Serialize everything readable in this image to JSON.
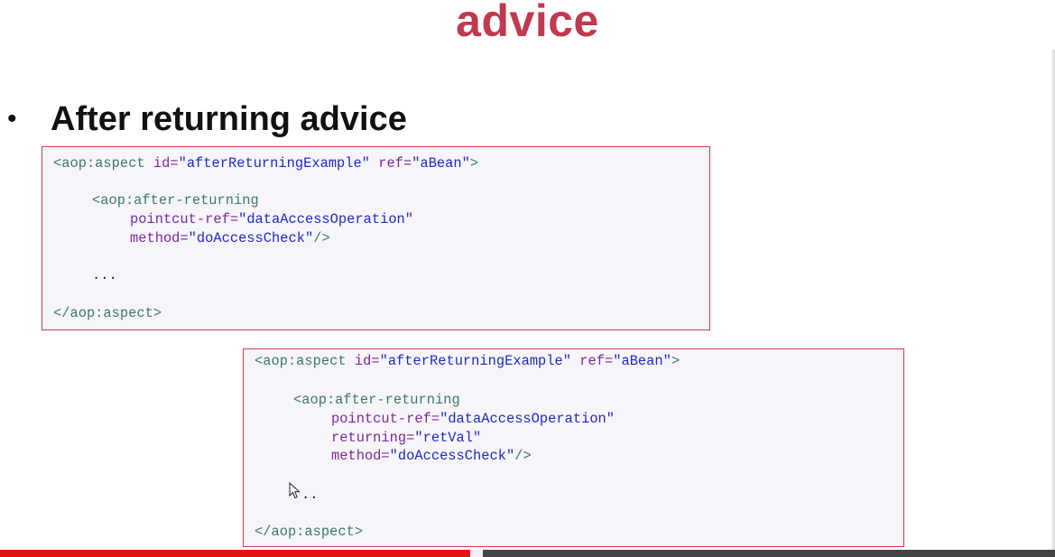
{
  "slide": {
    "title": "advice",
    "bullet": {
      "symbol": "•",
      "text": "After returning advice"
    }
  },
  "code_block_1": {
    "aspect_open": {
      "tag": "<aop:aspect",
      "id_attr": "id=",
      "id_val": "\"afterReturningExample\"",
      "ref_attr": "ref=",
      "ref_val": "\"aBean\"",
      "close": ">"
    },
    "advice_open": "<aop:after-returning",
    "pointcut": {
      "attr": "pointcut-ref=",
      "val": "\"dataAccessOperation\""
    },
    "method": {
      "attr": "method=",
      "val": "\"doAccessCheck\"",
      "close": "/>"
    },
    "ellipsis": "...",
    "aspect_close": "</aop:aspect>"
  },
  "code_block_2": {
    "aspect_open": {
      "tag": "<aop:aspect",
      "id_attr": "id=",
      "id_val": "\"afterReturningExample\"",
      "ref_attr": "ref=",
      "ref_val": "\"aBean\"",
      "close": ">"
    },
    "advice_open": "<aop:after-returning",
    "pointcut": {
      "attr": "pointcut-ref=",
      "val": "\"dataAccessOperation\""
    },
    "returning": {
      "attr": "returning=",
      "val": "\"retVal\""
    },
    "method": {
      "attr": "method=",
      "val": "\"doAccessCheck\"",
      "close": "/>"
    },
    "ellipsis": "..",
    "aspect_close": "</aop:aspect>"
  },
  "video_player": {
    "progress_fraction": 0.446,
    "buffered_fraction": 0.455
  },
  "colors": {
    "title": "#c0394f",
    "box_border": "#d43b45",
    "box_background": "#f7f5f9",
    "tag": "#3b7a70",
    "attribute": "#7b2aa0",
    "value": "#1d2bc8",
    "progress_played": "#e11414"
  },
  "icons": {
    "cursor": "mouse-pointer-icon"
  }
}
